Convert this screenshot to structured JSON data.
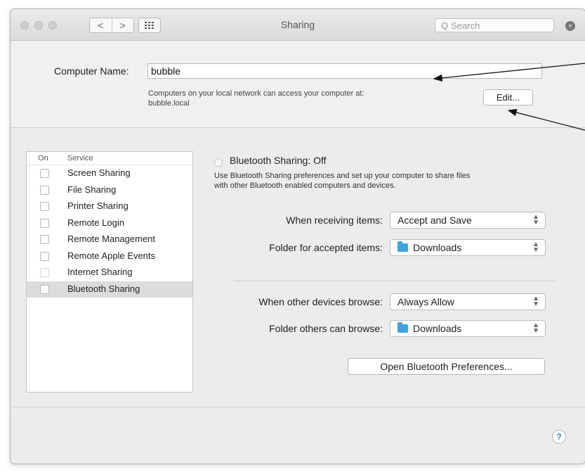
{
  "window": {
    "title": "Sharing",
    "back_glyph": "<",
    "forward_glyph": ">",
    "search_placeholder": "Search",
    "search_glyph": "Q",
    "clear_glyph": "×"
  },
  "computer_name": {
    "label": "Computer Name:",
    "value": "bubble",
    "help_line1": "Computers on your local network can access your computer at:",
    "help_line2": "bubble.local",
    "edit_label": "Edit..."
  },
  "services": {
    "header_on": "On",
    "header_service": "Service",
    "items": [
      {
        "label": "Screen Sharing"
      },
      {
        "label": "File Sharing"
      },
      {
        "label": "Printer Sharing"
      },
      {
        "label": "Remote Login"
      },
      {
        "label": "Remote Management"
      },
      {
        "label": "Remote Apple Events"
      },
      {
        "label": "Internet Sharing"
      },
      {
        "label": "Bluetooth Sharing"
      }
    ],
    "selected": "Bluetooth Sharing"
  },
  "bluetooth": {
    "status": "Bluetooth Sharing: Off",
    "description_line1": "Use Bluetooth Sharing preferences and set up your computer to share files",
    "description_line2": "with other Bluetooth enabled computers and devices.",
    "receiving_label": "When receiving items:",
    "receiving_value": "Accept and Save",
    "folder_accepted_label": "Folder for accepted items:",
    "folder_accepted_value": "Downloads",
    "browse_label": "When other devices browse:",
    "browse_value": "Always Allow",
    "folder_browse_label": "Folder others can browse:",
    "folder_browse_value": "Downloads",
    "open_prefs_label": "Open Bluetooth Preferences..."
  },
  "help_glyph": "?",
  "colors": {
    "folder_blue": "#3fa3e0",
    "help_blue": "#2f7fd6"
  }
}
